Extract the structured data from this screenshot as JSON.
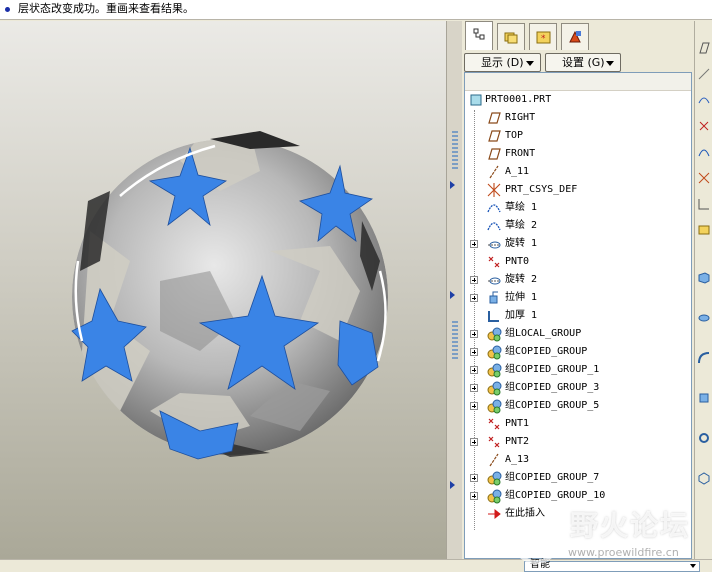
{
  "message": {
    "text": "层状态改变成功。重画来查看结果。"
  },
  "toolbar": {
    "show_label": "显示 (D)",
    "settings_label": "设置 (G)"
  },
  "tree": {
    "items": [
      {
        "label": "PRT0001.PRT",
        "icon": "part-icon",
        "expandable": false
      },
      {
        "label": "RIGHT",
        "icon": "datum-plane-icon",
        "expandable": false
      },
      {
        "label": "TOP",
        "icon": "datum-plane-icon",
        "expandable": false
      },
      {
        "label": "FRONT",
        "icon": "datum-plane-icon",
        "expandable": false
      },
      {
        "label": "A_11",
        "icon": "datum-axis-icon",
        "expandable": false
      },
      {
        "label": "PRT_CSYS_DEF",
        "icon": "csys-icon",
        "expandable": false
      },
      {
        "label": "草绘 1",
        "icon": "sketch-icon",
        "expandable": false
      },
      {
        "label": "草绘 2",
        "icon": "sketch-icon",
        "expandable": false
      },
      {
        "label": "旋转 1",
        "icon": "revolve-icon",
        "expandable": true
      },
      {
        "label": "PNT0",
        "icon": "datum-point-icon",
        "expandable": false
      },
      {
        "label": "旋转 2",
        "icon": "revolve-icon",
        "expandable": true
      },
      {
        "label": "拉伸 1",
        "icon": "extrude-icon",
        "expandable": true
      },
      {
        "label": "加厚 1",
        "icon": "thicken-icon",
        "expandable": false
      },
      {
        "label": "组LOCAL_GROUP",
        "icon": "group-icon",
        "expandable": true
      },
      {
        "label": "组COPIED_GROUP",
        "icon": "group-icon",
        "expandable": true
      },
      {
        "label": "组COPIED_GROUP_1",
        "icon": "group-icon",
        "expandable": true
      },
      {
        "label": "组COPIED_GROUP_3",
        "icon": "group-icon",
        "expandable": true
      },
      {
        "label": "组COPIED_GROUP_5",
        "icon": "group-icon",
        "expandable": true
      },
      {
        "label": "PNT1",
        "icon": "datum-point-icon",
        "expandable": false
      },
      {
        "label": "PNT2",
        "icon": "datum-point-icon",
        "expandable": true
      },
      {
        "label": "A_13",
        "icon": "datum-axis-icon",
        "expandable": false
      },
      {
        "label": "组COPIED_GROUP_7",
        "icon": "group-icon",
        "expandable": true
      },
      {
        "label": "组COPIED_GROUP_10",
        "icon": "group-icon",
        "expandable": true
      },
      {
        "label": "在此插入",
        "icon": "insert-here-arrow-icon",
        "expandable": false
      }
    ]
  },
  "status": {
    "filter_value": "智能"
  },
  "watermark": {
    "title": "野火论坛",
    "url": "www.proewildfire.cn"
  },
  "colors": {
    "star_blue": "#3a84e6",
    "sphere_grey": "#b9b9b9",
    "shell_dark": "#2a2a2a",
    "insert_arrow": "#d21a1a"
  }
}
